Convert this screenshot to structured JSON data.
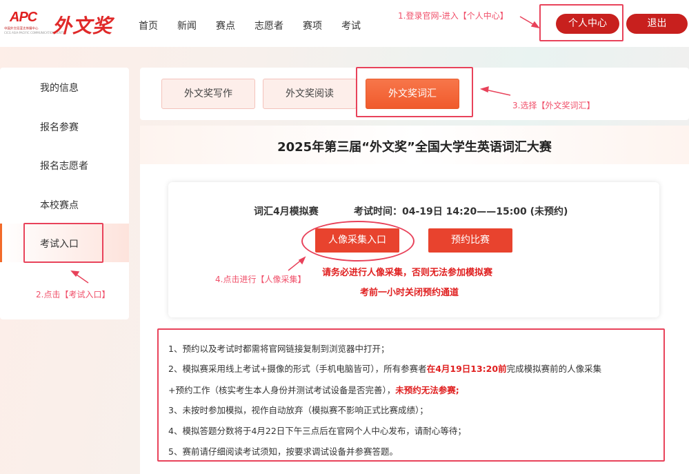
{
  "header": {
    "logo_text": "APC",
    "logo_subtitle": "中国外文局亚太传播中心",
    "logo_subtitle2": "CICG ASIA-PACIFIC COMMUNICATION CENTER",
    "brand": "外文奖",
    "nav": [
      "首页",
      "新闻",
      "赛点",
      "志愿者",
      "赛项",
      "考试"
    ],
    "user_center_label": "个人中心",
    "logout_label": "退出"
  },
  "annotations": {
    "step1": "1.登录官网-进入【个人中心】",
    "step2": "2.点击【考试入口】",
    "step3": "3.选择【外文奖词汇】",
    "step4": "4.点击进行【人像采集】"
  },
  "sidebar": {
    "items": [
      "我的信息",
      "报名参赛",
      "报名志愿者",
      "本校赛点",
      "考试入口"
    ],
    "active_index": 4
  },
  "tabs": {
    "items": [
      "外文奖写作",
      "外文奖阅读",
      "外文奖词汇"
    ],
    "active_index": 2
  },
  "contest": {
    "title": "2025年第三届“外文奖”全国大学生英语词汇大赛",
    "exam_name": "词汇4月模拟赛",
    "exam_time": "考试时间：04-19日 14:20——15:00 (未预约)",
    "face_capture_label": "人像采集入口",
    "reserve_label": "预约比赛",
    "warning1": "请务必进行人像采集，否则无法参加模拟赛",
    "warning2": "考前一小时关闭预约通道"
  },
  "notes": {
    "n1": "1、预约以及考试时都需将官网链接复制到浏览器中打开；",
    "n2_pre": "2、模拟赛采用线上考试+摄像的形式（手机电脑皆可），所有参赛者",
    "n2_em": "在4月19日13:20前",
    "n2_post": "完成模拟赛前的人像采集",
    "n2b_pre": "+预约工作（核实考生本人身份并测试考试设备是否完善），",
    "n2b_em": "未预约无法参赛;",
    "n3": "3、未按时参加模拟，视作自动放弃（模拟赛不影响正式比赛成绩）；",
    "n4": "4、模拟答题分数将于4月22日下午三点后在官网个人中心发布，请耐心等待；",
    "n5": "5、赛前请仔细阅读考试须知，按要求调试设备并参赛答题。"
  },
  "colors": {
    "primary_red": "#c8201e",
    "active_orange": "#f05a2c",
    "annotation_pink": "#e8425a",
    "warning_red": "#e02020"
  }
}
